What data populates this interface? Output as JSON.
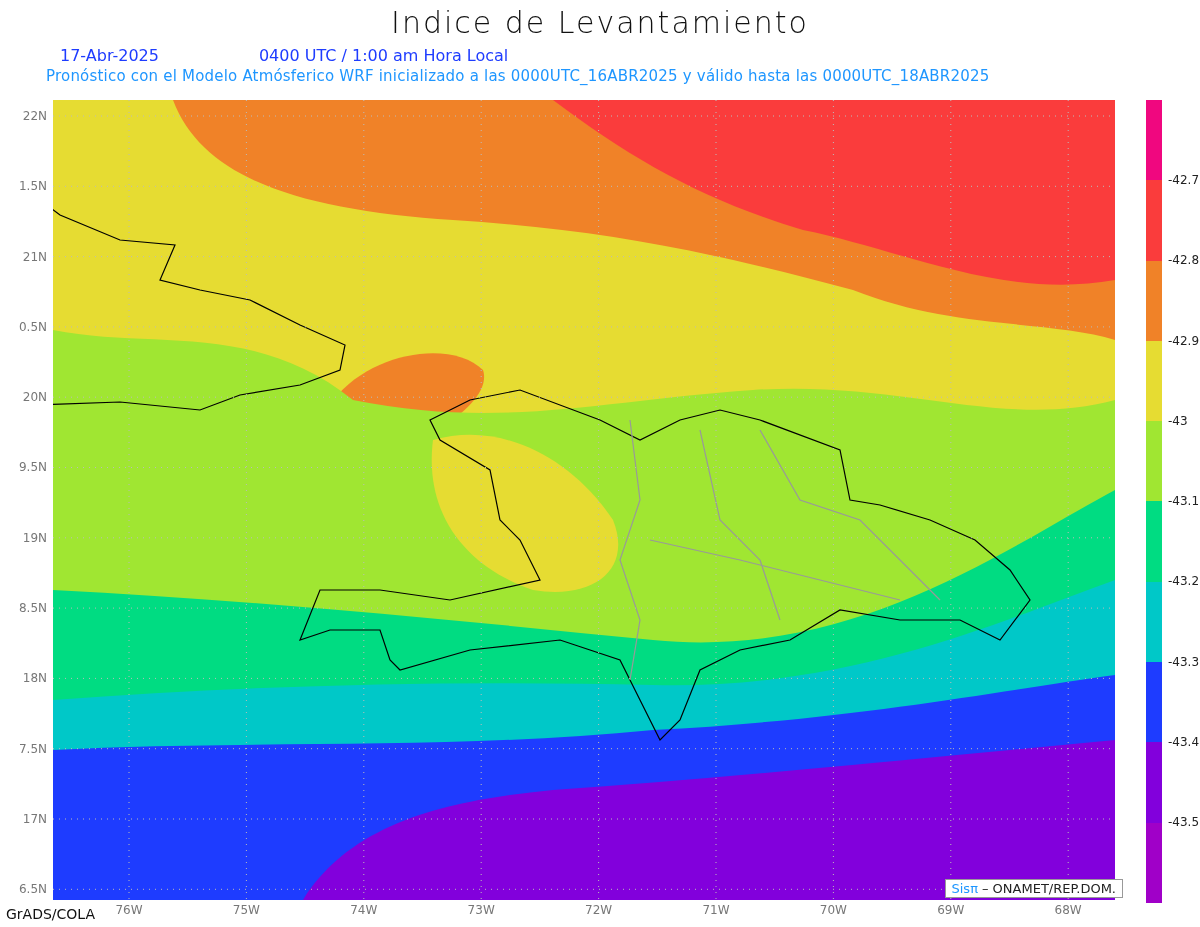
{
  "title": "Indice de Levantamiento",
  "date": "17-Abr-2025",
  "time": "0400 UTC / 1:00 am Hora Local",
  "subtitle": "Pronóstico con el Modelo Atmósferico WRF inicializado a las 0000UTC_16ABR2025 y válido hasta las  0000UTC_18ABR2025",
  "y_axis": [
    "22N",
    "1.5N",
    "21N",
    "0.5N",
    "20N",
    "9.5N",
    "19N",
    "8.5N",
    "18N",
    "7.5N",
    "17N",
    "6.5N"
  ],
  "x_axis": [
    "76W",
    "75W",
    "74W",
    "73W",
    "72W",
    "71W",
    "70W",
    "69W",
    "68W"
  ],
  "colorbar": {
    "segments": [
      {
        "color": "#f0077f"
      },
      {
        "color": "#fa3c3c"
      },
      {
        "color": "#f08228"
      },
      {
        "color": "#e6dc32"
      },
      {
        "color": "#a0e632"
      },
      {
        "color": "#00dc82"
      },
      {
        "color": "#00c8c8"
      },
      {
        "color": "#1e3cff"
      },
      {
        "color": "#8200dc"
      },
      {
        "color": "#a000c8"
      }
    ],
    "ticks": [
      "-42.7",
      "-42.8",
      "-42.9",
      "-43",
      "-43.1",
      "-43.2",
      "-43.3",
      "-43.4",
      "-43.5"
    ]
  },
  "credit": {
    "brand": "Sisπ",
    "text": "– ONAMET/REP.DOM."
  },
  "footer": "GrADS/COLA"
}
